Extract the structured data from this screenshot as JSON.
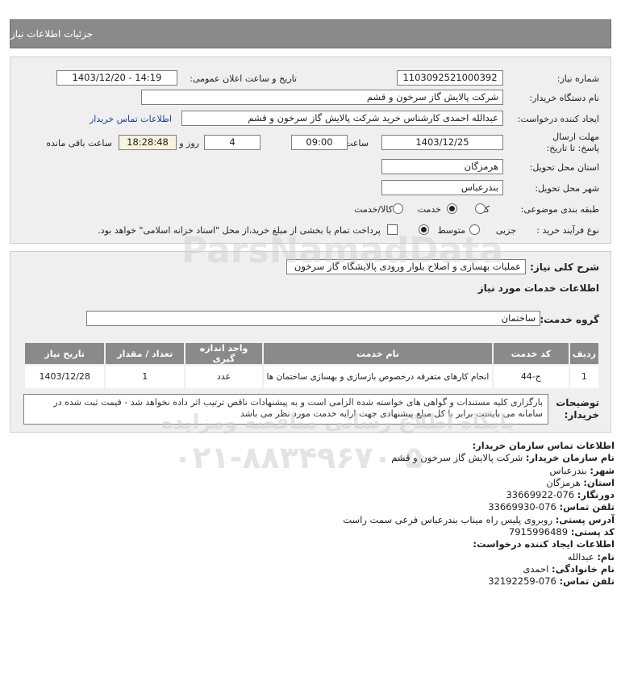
{
  "header": {
    "title": "جزئیات اطلاعات نیاز"
  },
  "details": {
    "need_number_label": "شماره نیاز:",
    "need_number": "1103092521000392",
    "announce_label": "تاریخ و ساعت اعلان عمومی:",
    "announce_value": "1403/12/20 - 14:19",
    "buyer_org_label": "نام دستگاه خریدار:",
    "buyer_org": "شرکت پالایش گاز سرخون و قشم",
    "creator_label": "ایجاد کننده درخواست:",
    "creator": "عبدالله احمدی کارشناس خرید شرکت پالایش گاز سرخون و قشم",
    "contact_link": "اطلاعات تماس خریدار",
    "deadline_label": "مهلت ارسال پاسخ: تا تاریخ:",
    "deadline_date": "1403/12/25",
    "time_label": "ساعت",
    "deadline_time": "09:00",
    "days_value": "4",
    "days_label": "روز و",
    "remaining_time": "18:28:48",
    "remaining_label": "ساعت باقی مانده",
    "province_label": "استان محل تحویل:",
    "province": "هرمزگان",
    "city_label": "شهر محل تحویل:",
    "city": "بندرعباس",
    "category_label": "طبقه بندی موضوعی:",
    "category_options": [
      "کالا",
      "خدمت",
      "کالا/خدمت"
    ],
    "process_label": "نوع فرآیند خرید :",
    "process_options": [
      "جزیی",
      "متوسط"
    ],
    "treasury_note": "پرداخت تمام یا بخشی از مبلغ خرید،از محل \"اسناد خزانه اسلامی\" خواهد بود."
  },
  "need": {
    "summary_label": "شرح کلی نیاز:",
    "summary": "عملیات بهسازی و اصلاح بلوار ورودی پالایشگاه گاز سرخون",
    "services_heading": "اطلاعات خدمات مورد نیاز",
    "service_group_label": "گروه خدمت:",
    "service_group": "ساختمان",
    "table": {
      "headers": [
        "ردیف",
        "کد خدمت",
        "نام خدمت",
        "واحد اندازه گیری",
        "تعداد / مقدار",
        "تاریخ نیاز"
      ],
      "rows": [
        [
          "1",
          "ج-44",
          "انجام کارهای متفرقه درخصوص بازسازی و بهسازی ساختمان ها",
          "عدد",
          "1",
          "1403/12/28"
        ]
      ]
    },
    "buyer_notes_label": "توضیحات خریدار:",
    "buyer_notes": "بارگزاری کلیه مستندات و گواهی های خواسته شده الزامی است و به پیشنهادات ناقص ترتیب اثر داده نخواهد شد - قیمت ثبت شده در سامانه می بایست برابر با کل مبلغ پیشنهادی جهت ارایه خدمت مورد نظر می باشد"
  },
  "contact": {
    "org_heading": "اطلاعات تماس سازمان خریدار:",
    "org_name_label": "نام سازمان خریدار:",
    "org_name": "شرکت پالایش گاز سرخون و قشم",
    "city_label": "شهر:",
    "city": "بندرعباس",
    "province_label": "استان:",
    "province": "هرمزگان",
    "fax_label": "دورنگار:",
    "fax": "076-33669922",
    "phone_label": "تلفن تماس:",
    "phone": "076-33669930",
    "address_label": "آدرس پستی:",
    "address": "روبروی پلیس راه میناب بندرعباس فرعی سمت راست",
    "postal_label": "کد پستی:",
    "postal": "7915996489",
    "creator_heading": "اطلاعات ایجاد کننده درخواست:",
    "first_name_label": "نام:",
    "first_name": "عبدالله",
    "last_name_label": "نام خانوادگی:",
    "last_name": "احمدی",
    "creator_phone_label": "تلفن تماس:",
    "creator_phone": "076-32192259"
  },
  "watermark": {
    "brand": "ParsNamadData",
    "tagline": "پایگاه اطلاع رسانی مناقصه ومزایده",
    "phone": "۰۲۱-۸۸۳۴۹۶۷۰-۵"
  }
}
